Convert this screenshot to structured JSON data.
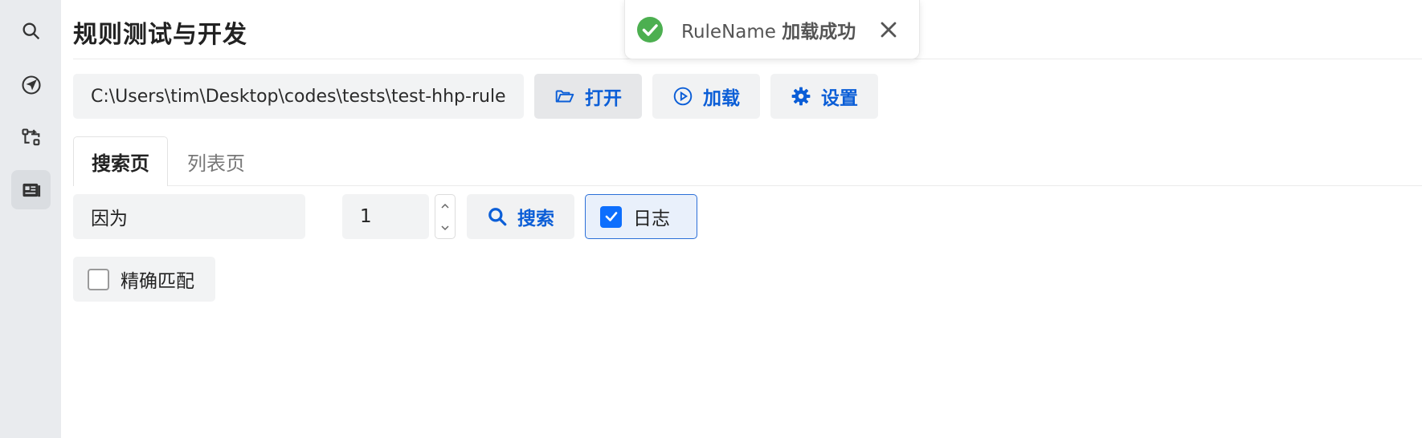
{
  "sidebar": {
    "items": [
      {
        "icon": "search-icon"
      },
      {
        "icon": "navigation-arrow-icon"
      },
      {
        "icon": "flow-icon"
      },
      {
        "icon": "rule-test-icon",
        "active": true
      }
    ]
  },
  "page": {
    "title": "规则测试与开发"
  },
  "toolbar": {
    "path_value": "C:\\Users\\tim\\Desktop\\codes\\tests\\test-hhp-rule",
    "open_label": "打开",
    "load_label": "加载",
    "settings_label": "设置"
  },
  "tabs": [
    {
      "label": "搜索页",
      "active": true
    },
    {
      "label": "列表页",
      "active": false
    }
  ],
  "search": {
    "query_value": "因为",
    "page_value": "1",
    "search_label": "搜索",
    "log_label": "日志",
    "log_checked": true,
    "exact_label": "精确匹配",
    "exact_checked": false
  },
  "toast": {
    "rule_name": "RuleName",
    "message": "加载成功",
    "status_color": "#4caf50"
  },
  "colors": {
    "accent": "#0b5ed7",
    "sidebar_bg": "#e9ebee"
  }
}
